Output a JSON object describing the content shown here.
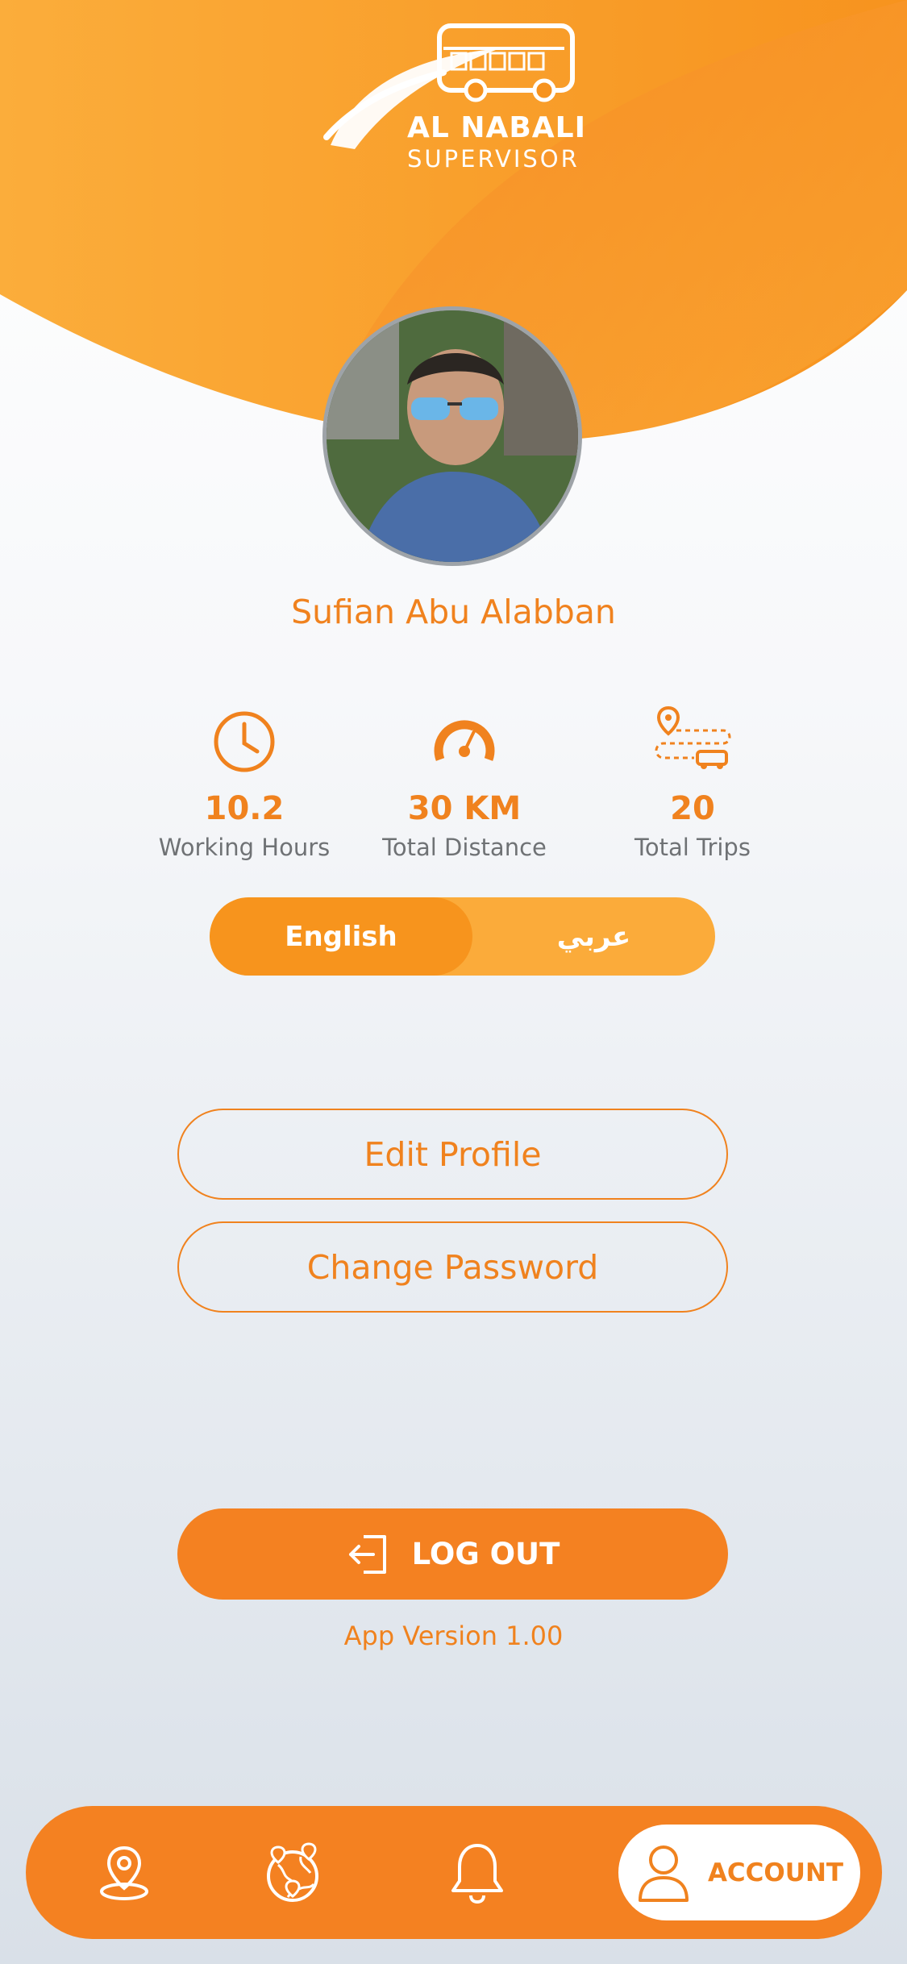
{
  "brand": {
    "title": "AL NABALI",
    "subtitle": "SUPERVISOR"
  },
  "profile": {
    "name": "Sufian Abu Alabban"
  },
  "stats": [
    {
      "value": "10.2",
      "label": "Working Hours",
      "icon": "clock-icon"
    },
    {
      "value": "30 KM",
      "label": "Total Distance",
      "icon": "speedometer-icon"
    },
    {
      "value": "20",
      "label": "Total Trips",
      "icon": "route-bus-icon"
    }
  ],
  "language": {
    "english": "English",
    "arabic": "عربي",
    "selected": "English"
  },
  "actions": {
    "edit_profile": "Edit Profile",
    "change_password": "Change Password",
    "logout": "LOG OUT"
  },
  "app_version": "App Version  1.00",
  "nav": {
    "items": [
      {
        "icon": "map-pin-icon"
      },
      {
        "icon": "globe-route-icon"
      },
      {
        "icon": "bell-icon"
      }
    ],
    "active_label": "ACCOUNT",
    "active_icon": "user-icon"
  },
  "colors": {
    "primary": "#f48121",
    "secondary": "#fbab3a",
    "text_muted": "#6f7275"
  }
}
